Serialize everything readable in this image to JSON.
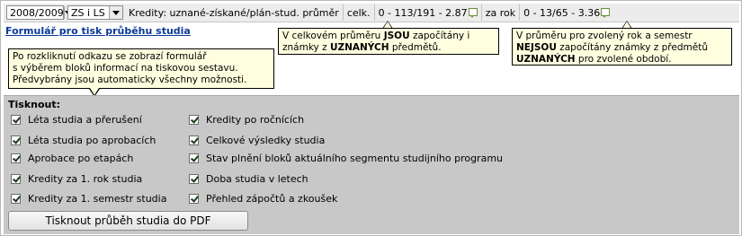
{
  "topbar": {
    "year_select": "2008/2009",
    "semester_select": "ZS i LS",
    "credits_label": "Kredity: uznané-získané/plán-stud. průměr",
    "total_label": "celk.",
    "total_value": "0 - 113/191 - 2.87",
    "year_label": "za rok",
    "year_value": "0 - 13/65 - 3.36"
  },
  "link_text": "Formulář pro tisk průběhu studia",
  "tooltips": {
    "total": {
      "pre": "V celkovém průměru ",
      "strong1": "JSOU",
      "mid": " započítány i známky z ",
      "strong2": "UZNANÝCH",
      "post": " předmětů."
    },
    "year": {
      "pre": "V průměru pro zvolený rok a semestr ",
      "strong1": "NEJSOU",
      "mid": " započítány známky z předmětů ",
      "strong2": "UZNANÝCH",
      "post": " pro zvolené období."
    },
    "link": {
      "line1": "Po rozkliknutí odkazu se zobrazí formulář",
      "line2": "s výběrem bloků informací na tiskovou sestavu.",
      "line3": "Předvybrány jsou automaticky všechny možnosti."
    }
  },
  "print": {
    "title": "Tisknout:",
    "left": [
      "Léta studia a přerušení",
      "Léta studia po aprobacích",
      "Aprobace po etapách",
      "Kredity za 1. rok studia",
      "Kredity za 1. semestr studia"
    ],
    "right": [
      "Kredity po ročnících",
      "Celkové výsledky studia",
      "Stav plnění bloků aktuálního segmentu studijního programu",
      "Doba studia v letech",
      "Přehled zápočtů a zkoušek"
    ],
    "button": "Tisknout průběh studia do PDF"
  }
}
